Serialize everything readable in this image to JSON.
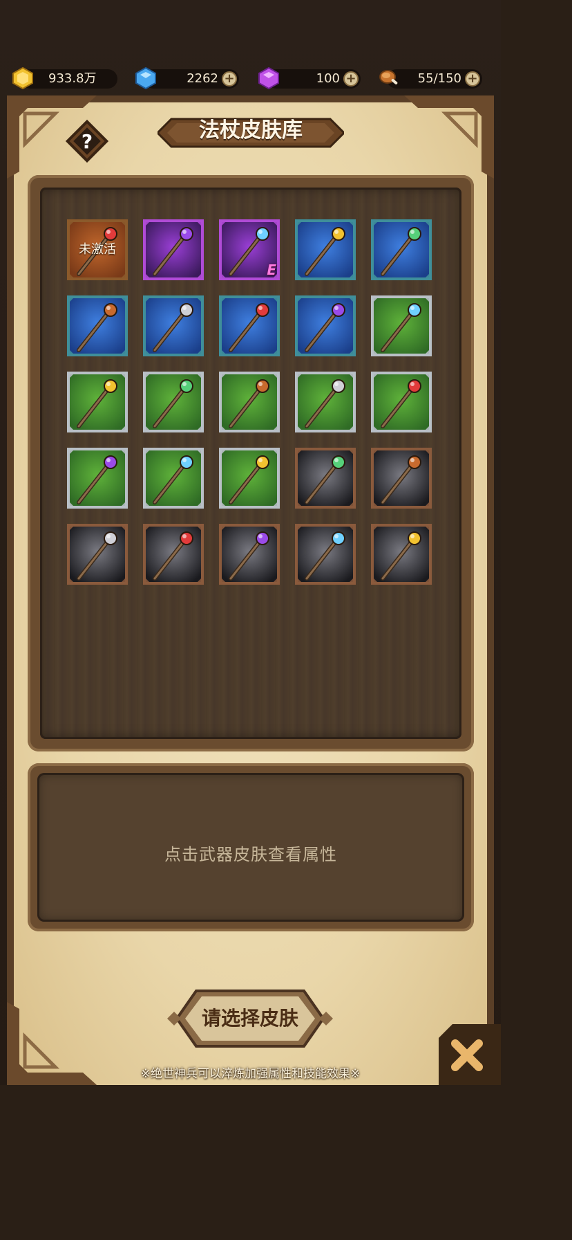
{
  "currency": {
    "gold": "933.8万",
    "diamond": "2262",
    "crystal": "100",
    "stamina": "55/150"
  },
  "header": {
    "title": "法杖皮肤库"
  },
  "skins": [
    {
      "name": "wooden-branch-staff",
      "frame": "bronze",
      "locked": true,
      "locked_label": "未激活"
    },
    {
      "name": "paw-staff",
      "frame": "purple"
    },
    {
      "name": "golden-orb-staff",
      "frame": "purple",
      "badge": "E"
    },
    {
      "name": "dark-crystal-staff",
      "frame": "teal"
    },
    {
      "name": "twisted-root-staff",
      "frame": "teal"
    },
    {
      "name": "ice-crystal-staff",
      "frame": "teal"
    },
    {
      "name": "emerald-ring-staff",
      "frame": "teal"
    },
    {
      "name": "winged-gem-staff",
      "frame": "teal"
    },
    {
      "name": "hooked-wood-staff",
      "frame": "teal"
    },
    {
      "name": "red-orb-staff",
      "frame": "silver"
    },
    {
      "name": "amethyst-staff",
      "frame": "silver"
    },
    {
      "name": "crescent-orb-staff",
      "frame": "silver"
    },
    {
      "name": "winged-eye-staff",
      "frame": "silver"
    },
    {
      "name": "thorn-vine-staff",
      "frame": "silver"
    },
    {
      "name": "flower-vine-staff",
      "frame": "silver"
    },
    {
      "name": "spear-tip-staff",
      "frame": "silver"
    },
    {
      "name": "pearl-claw-staff",
      "frame": "silver"
    },
    {
      "name": "dead-branch-staff",
      "frame": "silver"
    },
    {
      "name": "trident-staff",
      "frame": "brown"
    },
    {
      "name": "knobbed-club-staff",
      "frame": "brown"
    },
    {
      "name": "iron-spike-staff",
      "frame": "brown"
    },
    {
      "name": "ruby-pike-staff",
      "frame": "brown"
    },
    {
      "name": "bone-axe-staff",
      "frame": "brown"
    },
    {
      "name": "forked-stick-staff",
      "frame": "brown"
    },
    {
      "name": "shepherd-crook-staff",
      "frame": "brown"
    }
  ],
  "info": {
    "hint": "点击武器皮肤查看属性"
  },
  "actions": {
    "select_label": "请选择皮肤"
  },
  "footnote": "※绝世神兵可以淬炼加强属性和技能效果※",
  "colors": {
    "frame_bronze": "#8b5a2b",
    "frame_purple": "#b04bd6",
    "frame_teal": "#3f8f9a",
    "frame_silver": "#b9c0c6",
    "frame_brown": "#8a5a3c",
    "bg_purple": "#3b1a5c",
    "bg_blue": "#1b3f8a",
    "bg_green": "#2f6b25",
    "bg_dark": "#1a1a1e"
  }
}
